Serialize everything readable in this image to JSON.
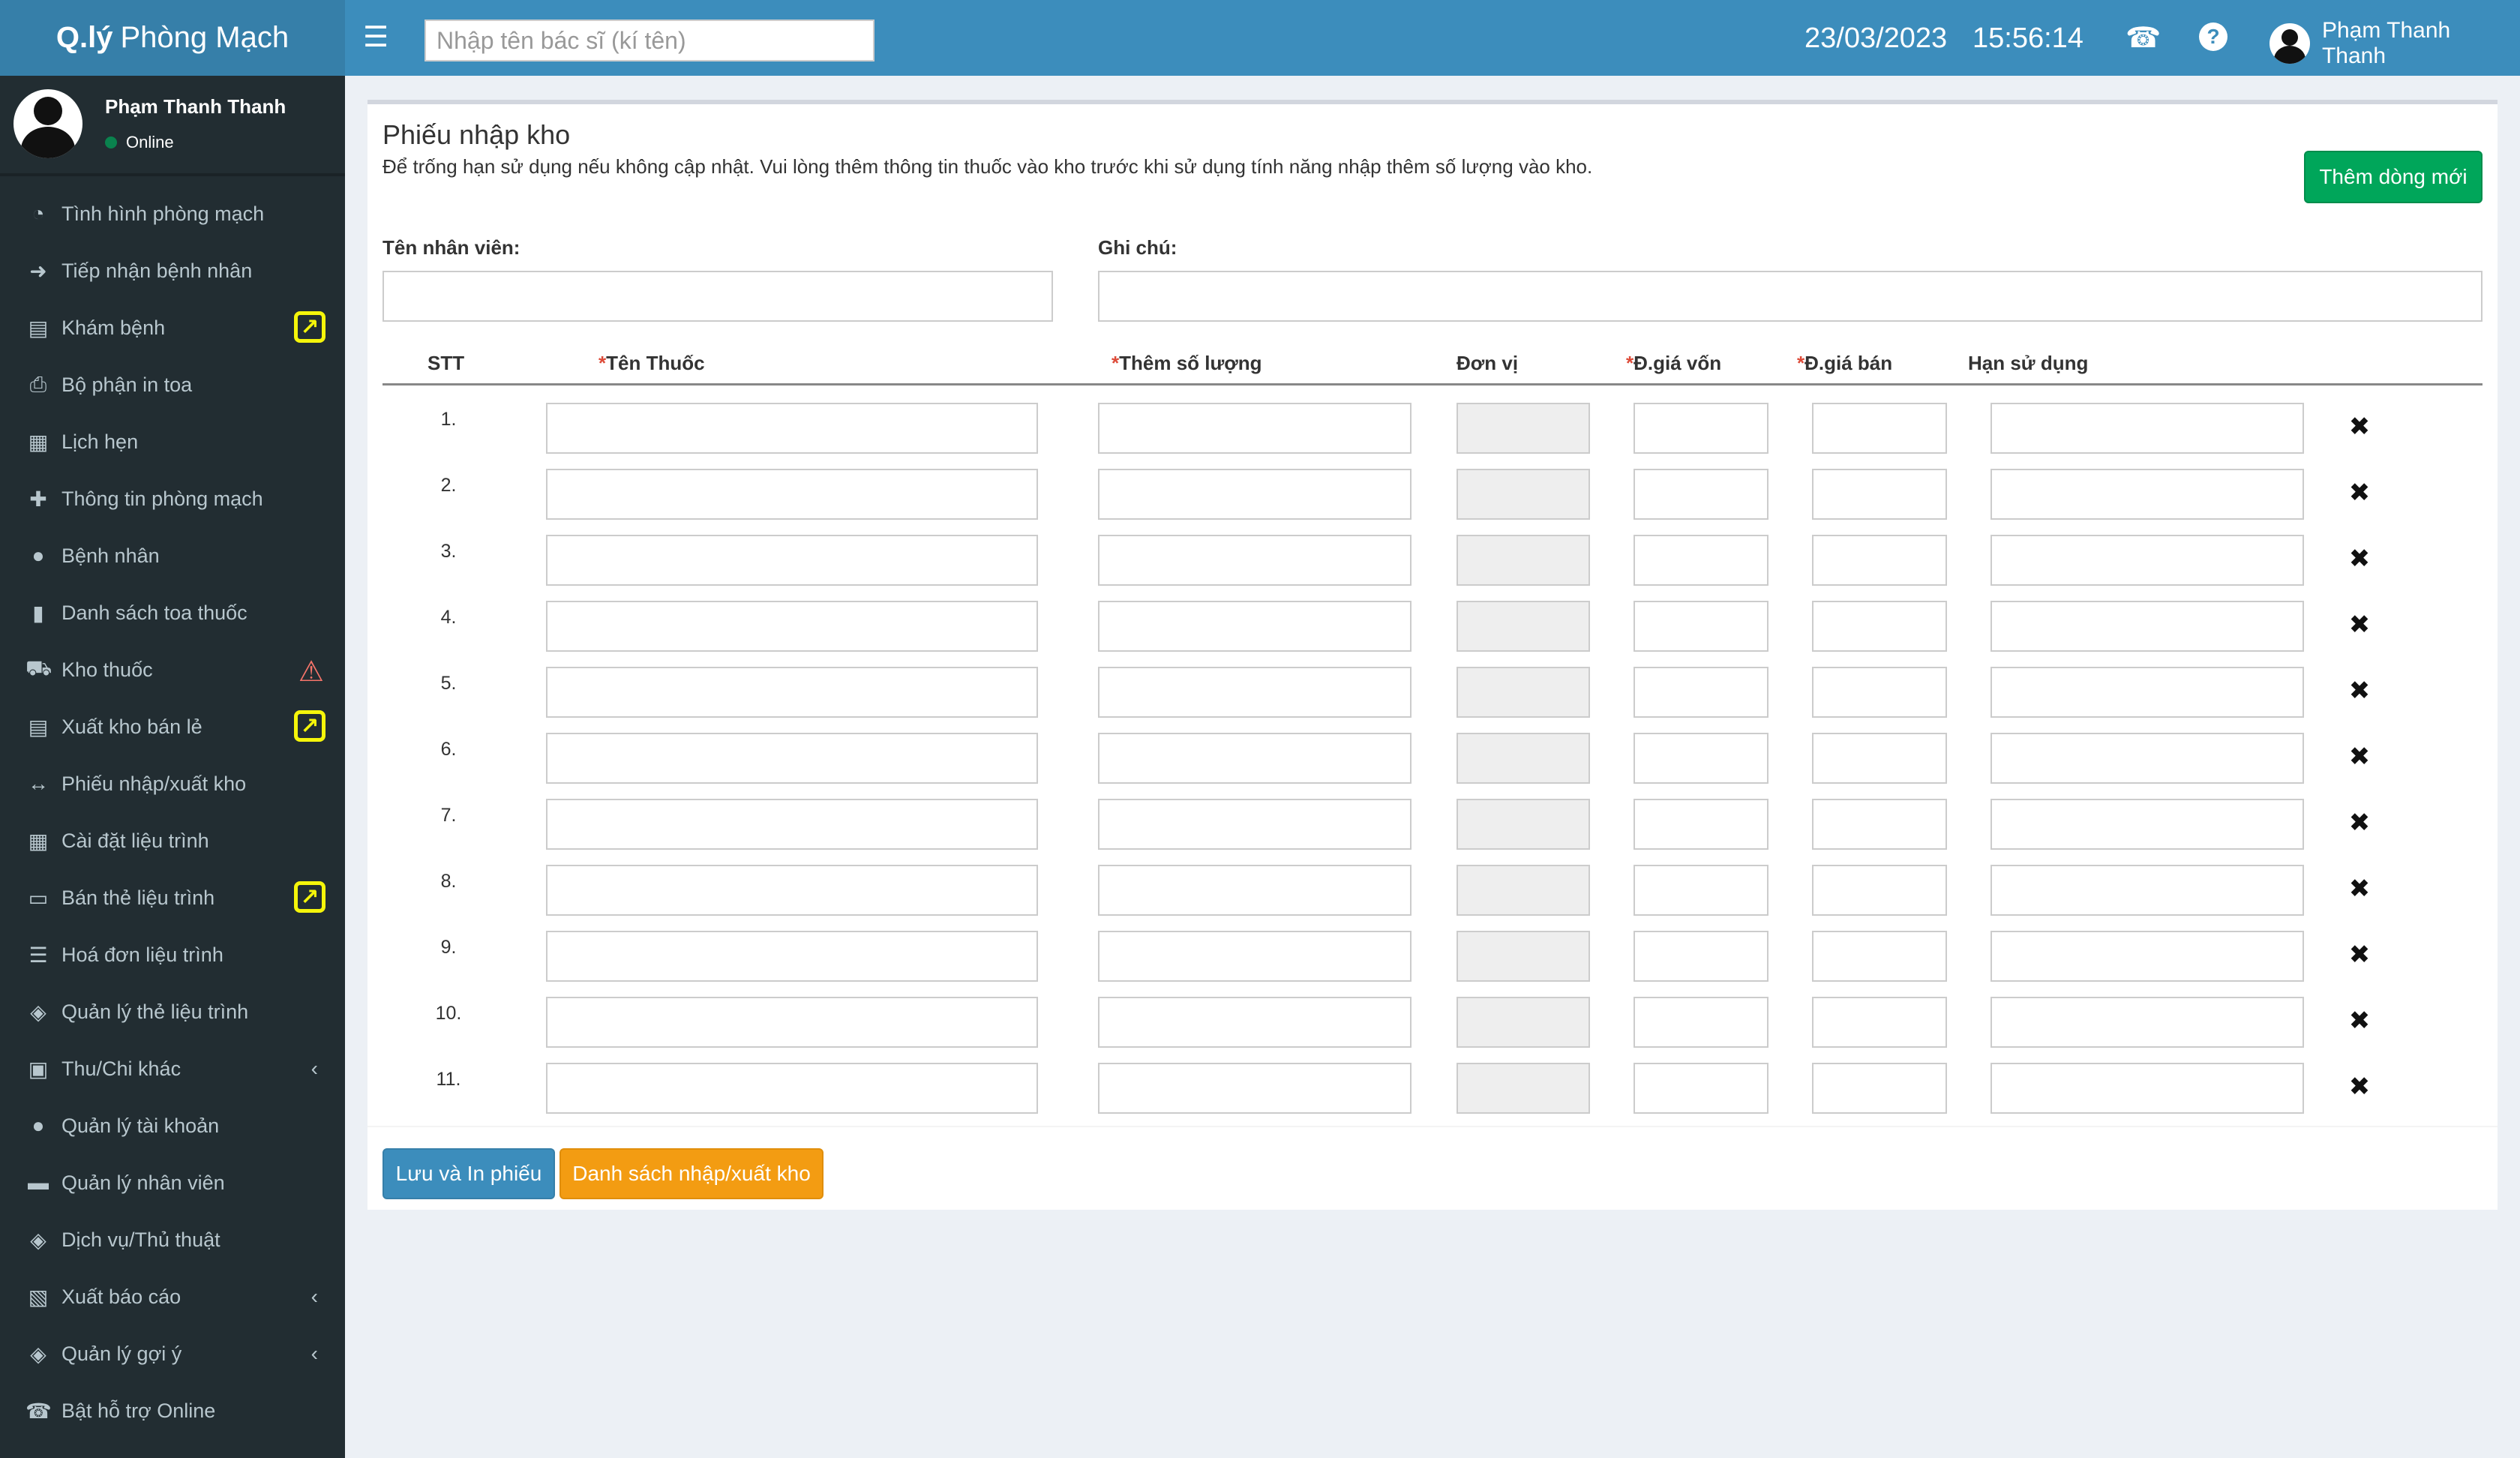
{
  "header": {
    "logo_bold": "Q.lý",
    "logo_light": "Phòng Mạch",
    "search_placeholder": "Nhập tên bác sĩ (kí tên)",
    "date": "23/03/2023",
    "time": "15:56:14",
    "user_name": "Phạm Thanh Thanh"
  },
  "sidebar": {
    "user_name": "Phạm Thanh Thanh",
    "status": "Online",
    "items": [
      {
        "label": "Tình hình phòng mạch",
        "icon": "pie-chart-icon",
        "glyph": "◔"
      },
      {
        "label": "Tiếp nhận bệnh nhân",
        "icon": "sign-in-icon",
        "glyph": "➜"
      },
      {
        "label": "Khám bệnh",
        "icon": "clipboard-icon",
        "glyph": "▤"
      },
      {
        "label": "Bộ phận in toa",
        "icon": "print-icon",
        "glyph": "⎙"
      },
      {
        "label": "Lịch hẹn",
        "icon": "calendar-icon",
        "glyph": "▦"
      },
      {
        "label": "Thông tin phòng mạch",
        "icon": "plus-icon",
        "glyph": "✚"
      },
      {
        "label": "Bệnh nhân",
        "icon": "user-icon",
        "glyph": "●"
      },
      {
        "label": "Danh sách toa thuốc",
        "icon": "file-icon",
        "glyph": "▮"
      },
      {
        "label": "Kho thuốc",
        "icon": "truck-icon",
        "glyph": "⛟"
      },
      {
        "label": "Xuất kho bán lẻ",
        "icon": "clipboard-icon",
        "glyph": "▤"
      },
      {
        "label": "Phiếu nhập/xuất kho",
        "icon": "arrows-h-icon",
        "glyph": "↔"
      },
      {
        "label": "Cài đặt liệu trình",
        "icon": "table-icon",
        "glyph": "▦"
      },
      {
        "label": "Bán thẻ liệu trình",
        "icon": "credit-card-icon",
        "glyph": "▭"
      },
      {
        "label": "Hoá đơn liệu trình",
        "icon": "list-icon",
        "glyph": "☰"
      },
      {
        "label": "Quản lý thẻ liệu trình",
        "icon": "tags-icon",
        "glyph": "◈"
      },
      {
        "label": "Thu/Chi khác",
        "icon": "money-icon",
        "glyph": "▣"
      },
      {
        "label": "Quản lý tài khoản",
        "icon": "users-icon",
        "glyph": "●"
      },
      {
        "label": "Quản lý nhân viên",
        "icon": "briefcase-icon",
        "glyph": "▬"
      },
      {
        "label": "Dịch vụ/Thủ thuật",
        "icon": "tags-icon",
        "glyph": "◈"
      },
      {
        "label": "Xuất báo cáo",
        "icon": "excel-file-icon",
        "glyph": "▧"
      },
      {
        "label": "Quản lý gợi ý",
        "icon": "tags-icon",
        "glyph": "◈"
      },
      {
        "label": "Bật hỗ trợ Online",
        "icon": "phone-icon",
        "glyph": "☎"
      }
    ]
  },
  "form": {
    "title": "Phiếu nhập kho",
    "note": "Để trống hạn sử dụng nếu không cập nhật. Vui lòng thêm thông tin thuốc vào kho trước khi sử dụng tính năng nhập thêm số lượng vào kho.",
    "add_row_button": "Thêm dòng mới",
    "staff_label": "Tên nhân viên:",
    "note_label": "Ghi chú:",
    "columns": {
      "stt": "STT",
      "drug": "Tên Thuốc",
      "qty": "Thêm số lượng",
      "unit": "Đơn vị",
      "cost": "Đ.giá vốn",
      "price": "Đ.giá bán",
      "expiry": "Hạn sử dụng"
    },
    "required_mark": "*",
    "rows": [
      "1.",
      "2.",
      "3.",
      "4.",
      "5.",
      "6.",
      "7.",
      "8.",
      "9.",
      "10.",
      "11."
    ],
    "delete_glyph": "✖",
    "save_button": "Lưu và In phiếu",
    "list_button": "Danh sách nhập/xuất kho"
  }
}
